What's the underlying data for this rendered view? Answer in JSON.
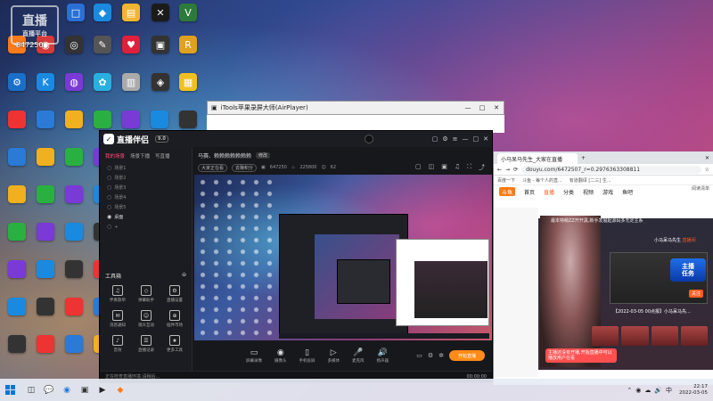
{
  "watermark": {
    "logo": "直播",
    "sub": "直播平台",
    "room_id": "647250"
  },
  "desktop_icons": [
    {
      "label": "",
      "glyph": "□",
      "color": "#2a6fd6"
    },
    {
      "label": "",
      "glyph": "◆",
      "color": "#1a8ae0"
    },
    {
      "label": "",
      "glyph": "▤",
      "color": "#f2b530"
    },
    {
      "label": "",
      "glyph": "✕",
      "color": "#1b1b1b"
    },
    {
      "label": "",
      "glyph": "V",
      "color": "#2d7a3a"
    },
    {
      "label": "",
      "glyph": "✦",
      "color": "#ff7a1a"
    },
    {
      "label": "",
      "glyph": "◉",
      "color": "#d63a3a"
    },
    {
      "label": "",
      "glyph": "◎",
      "color": "#333"
    },
    {
      "label": "",
      "glyph": "✎",
      "color": "#555"
    },
    {
      "label": "",
      "glyph": "♥",
      "color": "#e0203a"
    },
    {
      "label": "",
      "glyph": "▣",
      "color": "#333"
    },
    {
      "label": "",
      "glyph": "R",
      "color": "#e0a020"
    },
    {
      "label": "",
      "glyph": "⚙",
      "color": "#1a6fc8"
    },
    {
      "label": "",
      "glyph": "K",
      "color": "#1a8ae0"
    },
    {
      "label": "",
      "glyph": "◍",
      "color": "#7a3ad6"
    },
    {
      "label": "",
      "glyph": "✿",
      "color": "#2ab0e0"
    },
    {
      "label": "",
      "glyph": "▥",
      "color": "#aaa"
    },
    {
      "label": "",
      "glyph": "◈",
      "color": "#333"
    },
    {
      "label": "",
      "glyph": "▦",
      "color": "#f0c020"
    }
  ],
  "airplayer": {
    "title": "iTools苹果录屏大师(AirPlayer)"
  },
  "browser": {
    "tab": "小马呆马先生_大家在直播",
    "url": "douyu.com/6472507_r=0.2976363308811",
    "bookmarks": [
      "百度一下",
      "斗鱼 - 每个人的直...",
      "有道翻译 [二三] 生..."
    ],
    "read_mode": "阅读清单",
    "nav": [
      "首页",
      "直播",
      "分类",
      "视频",
      "游戏",
      "鱼吧"
    ],
    "logo": "斗鱼",
    "stage_title": "最本特萌ZZ开开黑,新手发展起源码多无定主系",
    "stage_user": "小马呆马先生",
    "stage_user_hl": "直播间",
    "task_badge": [
      "主播",
      "任务"
    ],
    "follow": "关注",
    "date_caption": "【2022-03-05 00点报】小马呆马先...",
    "chat": "主播还没有开播,开始直播中可以播放用户在看"
  },
  "app": {
    "brand": "直播伴侣",
    "version": "9.0",
    "left_tabs": [
      "我的场景",
      "场景下播",
      "写直播"
    ],
    "scenes": [
      {
        "label": "场景1",
        "on": false
      },
      {
        "label": "场景2",
        "on": false
      },
      {
        "label": "场景3",
        "on": false
      },
      {
        "label": "场景4",
        "on": false
      },
      {
        "label": "场景5",
        "on": false
      },
      {
        "label": "桌面",
        "on": true
      },
      {
        "label": "+",
        "on": false
      }
    ],
    "toolbox_title": "工具箱",
    "tools": [
      {
        "glyph": "♫",
        "label": "伴奏歌单"
      },
      {
        "glyph": "◇",
        "label": "弹幕助手"
      },
      {
        "glyph": "⚙",
        "label": "直播设置"
      },
      {
        "glyph": "✉",
        "label": "消息通知"
      },
      {
        "glyph": "☺",
        "label": "观众互动"
      },
      {
        "glyph": "⊕",
        "label": "插件市场"
      },
      {
        "glyph": "♪",
        "label": "音效"
      },
      {
        "glyph": "☰",
        "label": "直播记录"
      },
      {
        "glyph": "★",
        "label": "更多工具"
      }
    ],
    "info": {
      "title": "马赛、赖赖赖赖赖赖赖",
      "tag": "修改",
      "room": "647250",
      "fans": "225800",
      "count": "62"
    },
    "sub": {
      "pill1": "大家正在看",
      "pill2": "去赚积分"
    },
    "controls": [
      {
        "glyph": "▭",
        "label": "屏幕录像"
      },
      {
        "glyph": "◉",
        "label": "摄像头"
      },
      {
        "glyph": "▯",
        "label": "手机投屏"
      },
      {
        "glyph": "▷",
        "label": "多媒体"
      },
      {
        "glyph": "🎤",
        "label": "麦克风"
      },
      {
        "glyph": "🔊",
        "label": "扬声器"
      }
    ],
    "start_button": "开始直播",
    "status_left": "正在检查直播环境,请稍后...",
    "status_time": "00:00:00"
  },
  "taskbar": {
    "apps": [
      {
        "glyph": "◫",
        "color": "#333"
      },
      {
        "glyph": "💬",
        "color": "#2ab040"
      },
      {
        "glyph": "◉",
        "color": "#2a7ad6"
      },
      {
        "glyph": "▣",
        "color": "#333"
      },
      {
        "glyph": "▶",
        "color": "#222"
      },
      {
        "glyph": "◆",
        "color": "#ff7a1a"
      }
    ],
    "tray": [
      "⌃",
      "◉",
      "☁",
      "🔊",
      "中"
    ],
    "time": "22:17",
    "date": "2022-03-05"
  },
  "colors": {
    "accent": "#ff8c1a",
    "douyu_orange": "#ff5d23",
    "app_bg": "#17181c"
  }
}
